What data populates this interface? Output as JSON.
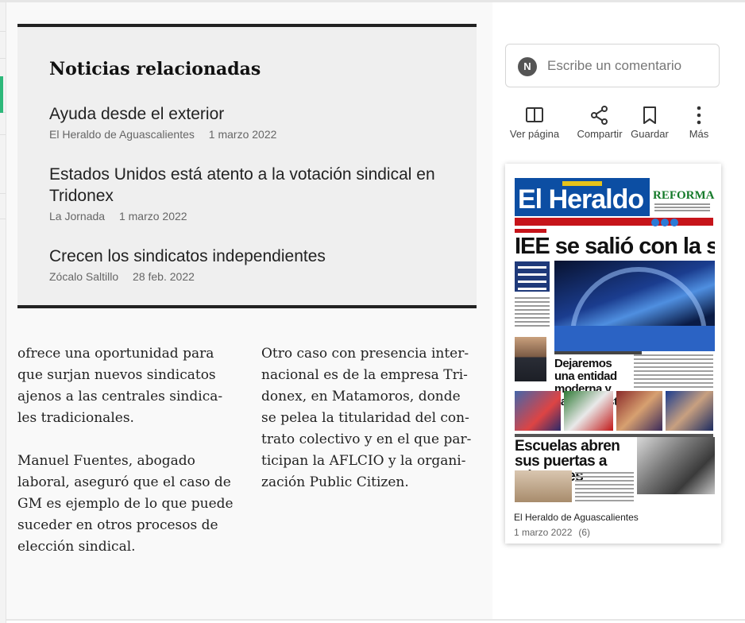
{
  "related": {
    "heading": "Noticias relacionadas",
    "items": [
      {
        "title": "Ayuda desde el exterior",
        "source": "El Heraldo de Aguascalientes",
        "date": "1 marzo 2022"
      },
      {
        "title": "Estados Unidos está atento a la votación sindical en Tridonex",
        "source": "La Jornada",
        "date": "1 marzo 2022"
      },
      {
        "title": "Crecen los sindicatos independientes",
        "source": "Zócalo Saltillo",
        "date": "28 feb. 2022"
      }
    ]
  },
  "article": {
    "col1": [
      "ofrece una oportunidad para que surjan nuevos sindicatos ajenos a las centrales sindica-les tradicionales.",
      "Manuel Fuentes, abogado laboral, aseguró que el caso de GM es ejemplo de lo que puede suceder en otros procesos de elección sindical."
    ],
    "col2": [
      "Otro caso con presencia inter-nacional es de la empresa Tri-donex, en Matamoros, donde se pelea la titularidad del con-trato colectivo y en el que par-ticipan la AFLCIO y la organi-zación Public Citizen."
    ]
  },
  "comment": {
    "avatar_initial": "N",
    "placeholder": "Escribe un comentario"
  },
  "actions": {
    "view_page": "Ver página",
    "share": "Compartir",
    "save": "Guardar",
    "more": "Más"
  },
  "issue_card": {
    "masthead": "El Heraldo",
    "partner": "REFORMA",
    "headline": "IEE se salió con la suya",
    "subhead": "Dejaremos una entidad moderna y vanguardista",
    "section_head": "Escuelas abren sus puertas a migrantes",
    "source": "El Heraldo de Aguascalientes",
    "date": "1 marzo 2022",
    "count": "(6)"
  },
  "colors": {
    "accent_green": "#2db87a",
    "masthead_blue": "#0c4ea3",
    "masthead_red": "#c6141a"
  }
}
